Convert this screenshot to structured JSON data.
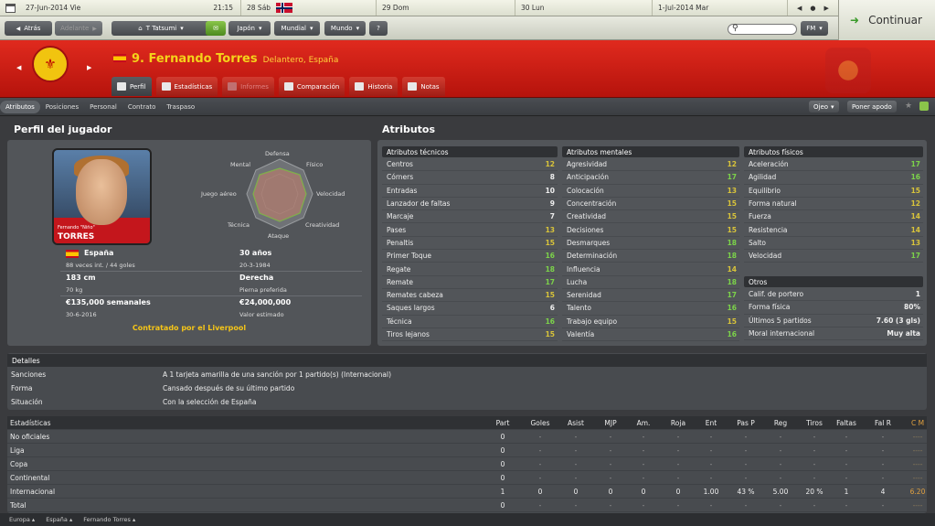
{
  "calendar": {
    "today": "27-Jun-2014 Vie",
    "time": "21:15",
    "days": [
      "28 Sáb",
      "29 Dom",
      "30 Lun",
      "1-Jul-2014 Mar"
    ]
  },
  "nav": {
    "back": "Atrás",
    "forward": "Adelante",
    "manager": "T Tatsumi",
    "country": "Japón",
    "world1": "Mundial",
    "world2": "Mundo",
    "help": "?",
    "fm": "FM",
    "continue": "Continuar"
  },
  "player": {
    "name": "9. Fernando Torres",
    "position": "Delantero, España"
  },
  "tabs": [
    "Perfil",
    "Estadísticas",
    "Informes",
    "Comparación",
    "Historia",
    "Notas"
  ],
  "subnav": [
    "Atributos",
    "Posiciones",
    "Personal",
    "Contrato",
    "Traspaso"
  ],
  "subbuttons": {
    "scout": "Ojeo",
    "nickname": "Poner apodo"
  },
  "profile": {
    "title": "Perfil del jugador",
    "photo_first": "Fernando \"Niño\"",
    "photo_last": "TORRES",
    "nation": "España",
    "caps": "88 veces int. / 44 goles",
    "age": "30 años",
    "dob": "20-3-1984",
    "height": "183 cm",
    "weight": "70 kg",
    "foot": "Derecha",
    "foot_label": "Pierna preferida",
    "wage": "€135,000 semanales",
    "wage_until": "30-6-2016",
    "value": "€24,000,000",
    "value_label": "Valor estimado",
    "contract": "Contratado por el Liverpool",
    "radar": {
      "defensa": "Defensa",
      "fisico": "Físico",
      "velocidad": "Velocidad",
      "creatividad": "Creatividad",
      "ataque": "Ataque",
      "tecnica": "Técnica",
      "juego_aereo": "Juego aéreo",
      "mental": "Mental"
    }
  },
  "attributes_title": "Atributos",
  "technical": {
    "title": "Atributos técnicos",
    "rows": [
      [
        "Centros",
        "12"
      ],
      [
        "Córners",
        "8"
      ],
      [
        "Entradas",
        "10"
      ],
      [
        "Lanzador de faltas",
        "9"
      ],
      [
        "Marcaje",
        "7"
      ],
      [
        "Pases",
        "13"
      ],
      [
        "Penaltis",
        "15"
      ],
      [
        "Primer Toque",
        "16"
      ],
      [
        "Regate",
        "18"
      ],
      [
        "Remate",
        "17"
      ],
      [
        "Remates cabeza",
        "15"
      ],
      [
        "Saques largos",
        "6"
      ],
      [
        "Técnica",
        "16"
      ],
      [
        "Tiros lejanos",
        "15"
      ]
    ]
  },
  "mental": {
    "title": "Atributos mentales",
    "rows": [
      [
        "Agresividad",
        "12"
      ],
      [
        "Anticipación",
        "17"
      ],
      [
        "Colocación",
        "13"
      ],
      [
        "Concentración",
        "15"
      ],
      [
        "Creatividad",
        "15"
      ],
      [
        "Decisiones",
        "15"
      ],
      [
        "Desmarques",
        "18"
      ],
      [
        "Determinación",
        "18"
      ],
      [
        "Influencia",
        "14"
      ],
      [
        "Lucha",
        "18"
      ],
      [
        "Serenidad",
        "17"
      ],
      [
        "Talento",
        "16"
      ],
      [
        "Trabajo equipo",
        "15"
      ],
      [
        "Valentía",
        "16"
      ]
    ]
  },
  "physical": {
    "title": "Atributos físicos",
    "rows": [
      [
        "Aceleración",
        "17"
      ],
      [
        "Agilidad",
        "16"
      ],
      [
        "Equilibrio",
        "15"
      ],
      [
        "Forma natural",
        "12"
      ],
      [
        "Fuerza",
        "14"
      ],
      [
        "Resistencia",
        "14"
      ],
      [
        "Salto",
        "13"
      ],
      [
        "Velocidad",
        "17"
      ]
    ]
  },
  "others": {
    "title": "Otros",
    "rows": [
      [
        "Calif. de portero",
        "1"
      ],
      [
        "Forma física",
        "80%"
      ],
      [
        "Últimos 5 partidos",
        "7.60 (3 gls)"
      ],
      [
        "Moral internacional",
        "Muy alta"
      ]
    ]
  },
  "details": {
    "title": "Detalles",
    "rows": [
      [
        "Sanciones",
        "A 1 tarjeta amarilla de una sanción por 1 partido(s) (Internacional)"
      ],
      [
        "Forma",
        "Cansado después de su último partido"
      ],
      [
        "Situación",
        "Con la selección de España"
      ]
    ]
  },
  "stats": {
    "title": "Estadísticas",
    "columns": [
      "Part",
      "Goles",
      "Asist",
      "MJP",
      "Am.",
      "Roja",
      "Ent",
      "Pas P",
      "Reg",
      "Tiros",
      "Faltas",
      "Fal R",
      "C M"
    ],
    "rows": [
      {
        "name": "No oficiales",
        "vals": [
          "0",
          "-",
          "-",
          "-",
          "-",
          "-",
          "-",
          "-",
          "-",
          "-",
          "-",
          "-",
          "----"
        ]
      },
      {
        "name": "Liga",
        "vals": [
          "0",
          "-",
          "-",
          "-",
          "-",
          "-",
          "-",
          "-",
          "-",
          "-",
          "-",
          "-",
          "----"
        ]
      },
      {
        "name": "Copa",
        "vals": [
          "0",
          "-",
          "-",
          "-",
          "-",
          "-",
          "-",
          "-",
          "-",
          "-",
          "-",
          "-",
          "----"
        ]
      },
      {
        "name": "Continental",
        "vals": [
          "0",
          "-",
          "-",
          "-",
          "-",
          "-",
          "-",
          "-",
          "-",
          "-",
          "-",
          "-",
          "----"
        ]
      },
      {
        "name": "Internacional",
        "vals": [
          "1",
          "0",
          "0",
          "0",
          "0",
          "0",
          "1.00",
          "43 %",
          "5.00",
          "20 %",
          "1",
          "4",
          "6.20"
        ]
      },
      {
        "name": "Total",
        "vals": [
          "0",
          "-",
          "-",
          "-",
          "-",
          "-",
          "-",
          "-",
          "-",
          "-",
          "-",
          "-",
          "----"
        ]
      }
    ]
  },
  "footer": [
    "Europa",
    "España",
    "Fernando Torres"
  ]
}
